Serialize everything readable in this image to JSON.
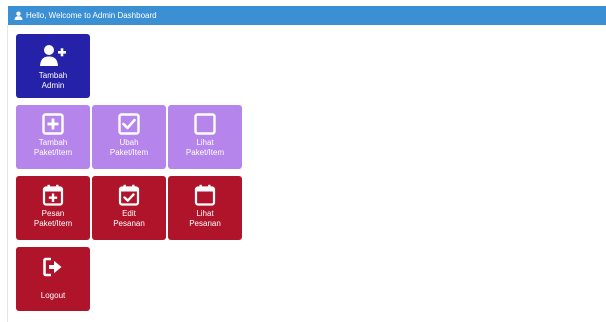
{
  "header": {
    "greeting": "Hello, Welcome to Admin Dashboard",
    "icon": "user-icon"
  },
  "colors": {
    "header_bg": "#3b8fd3",
    "admin_tile": "#2521a8",
    "paket_tile": "#b585eb",
    "pesanan_tile": "#b0142b",
    "logout_tile": "#b0142b"
  },
  "tiles": {
    "tambah_admin": {
      "label": "Tambah\nAdmin",
      "icon": "user-plus-icon"
    },
    "tambah_paket": {
      "label": "Tambah\nPaket/Item",
      "icon": "plus-square-icon"
    },
    "ubah_paket": {
      "label": "Ubah\nPaket/Item",
      "icon": "check-square-icon"
    },
    "lihat_paket": {
      "label": "Lihat\nPaket/Item",
      "icon": "square-icon"
    },
    "pesan_paket": {
      "label": "Pesan\nPaket/Item",
      "icon": "calendar-plus-icon"
    },
    "edit_pesanan": {
      "label": "Edit\nPesanan",
      "icon": "calendar-check-icon"
    },
    "lihat_pesanan": {
      "label": "Lihat\nPesanan",
      "icon": "calendar-icon"
    },
    "logout": {
      "label": "Logout",
      "icon": "sign-out-icon"
    }
  }
}
